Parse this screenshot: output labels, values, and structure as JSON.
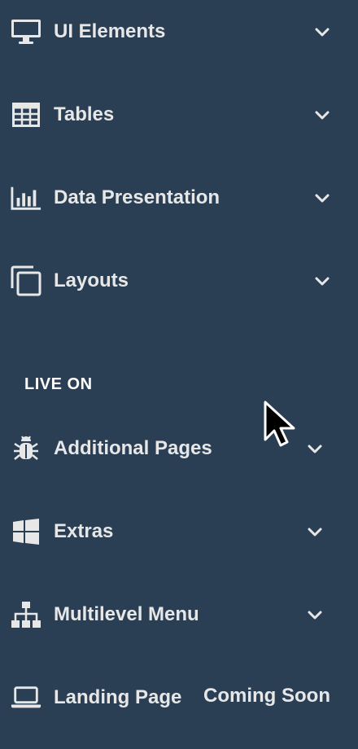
{
  "sidebar": {
    "section_general_items": [
      {
        "label": "UI Elements",
        "icon": "desktop-icon"
      },
      {
        "label": "Tables",
        "icon": "table-icon"
      },
      {
        "label": "Data Presentation",
        "icon": "bar-chart-icon"
      },
      {
        "label": "Layouts",
        "icon": "clone-icon"
      }
    ],
    "section_live_title": "LIVE ON",
    "section_live_items": [
      {
        "label": "Additional Pages",
        "icon": "bug-icon"
      },
      {
        "label": "Extras",
        "icon": "windows-icon"
      },
      {
        "label": "Multilevel Menu",
        "icon": "sitemap-icon"
      },
      {
        "label": "Landing Page",
        "icon": "laptop-icon",
        "badge": "Coming Soon"
      }
    ]
  },
  "colors": {
    "background": "#2a3f54",
    "text": "#e7e7e7",
    "icon": "#e7e7e7"
  },
  "cursor": {
    "icon": "mouse-pointer-icon"
  }
}
